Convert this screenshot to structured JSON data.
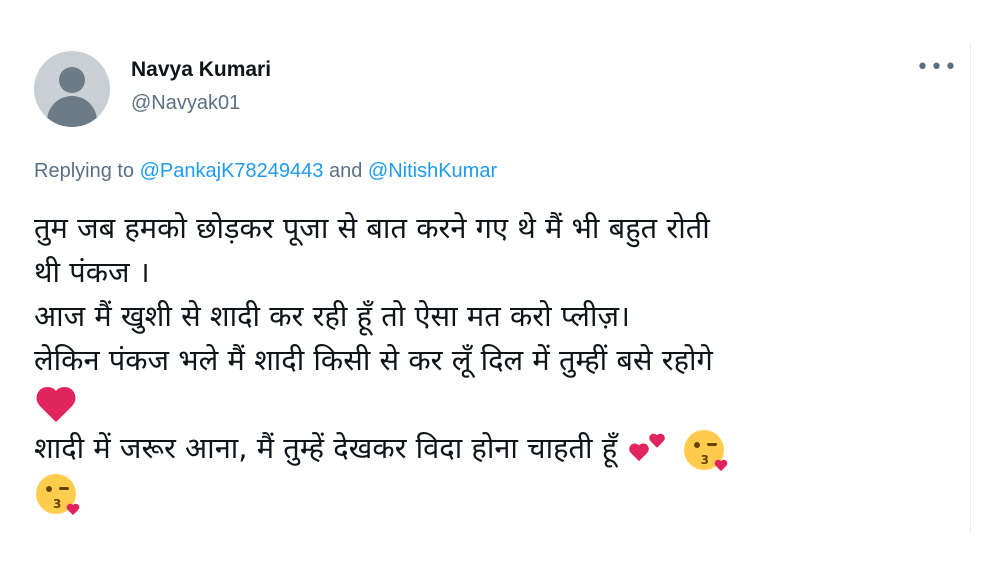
{
  "author": {
    "name": "Navya Kumari",
    "handle": "@Navyak01"
  },
  "more_icon": "more-horizontal-icon",
  "replying": {
    "prefix": "Replying to",
    "mention1": "@PankajK78249443",
    "joiner": "and",
    "mention2": "@NitishKumar"
  },
  "tweet": {
    "lines": [
      "तुम जब हमको छोड़कर पूजा से बात करने गए थे मैं भी बहुत रोती",
      "थी पंकज ।",
      "आज मैं खुशी से शादी कर रही हूँ तो ऐसा मत करो प्लीज़।",
      "लेकिन पंकज भले मैं शादी किसी से कर लूँ दिल में तुम्हीं बसे रहोगे",
      "शादी में जरूर आना, मैं तुम्हें देखकर विदा होना चाहती हूँ"
    ],
    "emojis": [
      "red-heart-emoji",
      "two-hearts-emoji",
      "face-blowing-kiss-emoji",
      "face-blowing-kiss-emoji"
    ]
  },
  "colors": {
    "mention": "#1d9bf0",
    "secondary_text": "#5b7083",
    "heart": "#e0245e",
    "face": "#ffcc4d"
  }
}
